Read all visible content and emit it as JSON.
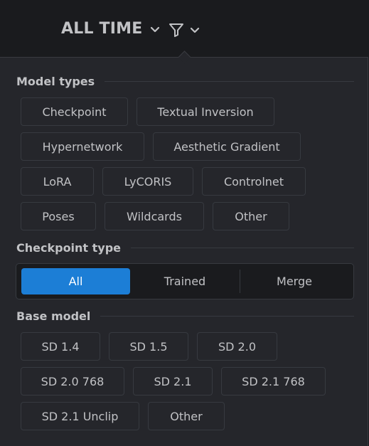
{
  "header": {
    "period_label": "ALL TIME",
    "period_icon": "chevron-down-icon",
    "filter_icon": "filter-icon",
    "filter_chevron_icon": "chevron-down-icon"
  },
  "filters": {
    "model_types": {
      "title": "Model types",
      "options": [
        "Checkpoint",
        "Textual Inversion",
        "Hypernetwork",
        "Aesthetic Gradient",
        "LoRA",
        "LyCORIS",
        "Controlnet",
        "Poses",
        "Wildcards",
        "Other"
      ]
    },
    "checkpoint_type": {
      "title": "Checkpoint type",
      "options": [
        "All",
        "Trained",
        "Merge"
      ],
      "selected": "All"
    },
    "base_model": {
      "title": "Base model",
      "options": [
        "SD 1.4",
        "SD 1.5",
        "SD 2.0",
        "SD 2.0 768",
        "SD 2.1",
        "SD 2.1 768",
        "SD 2.1 Unclip",
        "Other"
      ]
    }
  },
  "colors": {
    "accent": "#1c7ed6",
    "background": "#1a1b1e",
    "panel": "#25262b",
    "border": "#373a40",
    "text": "#c1c2c5"
  }
}
